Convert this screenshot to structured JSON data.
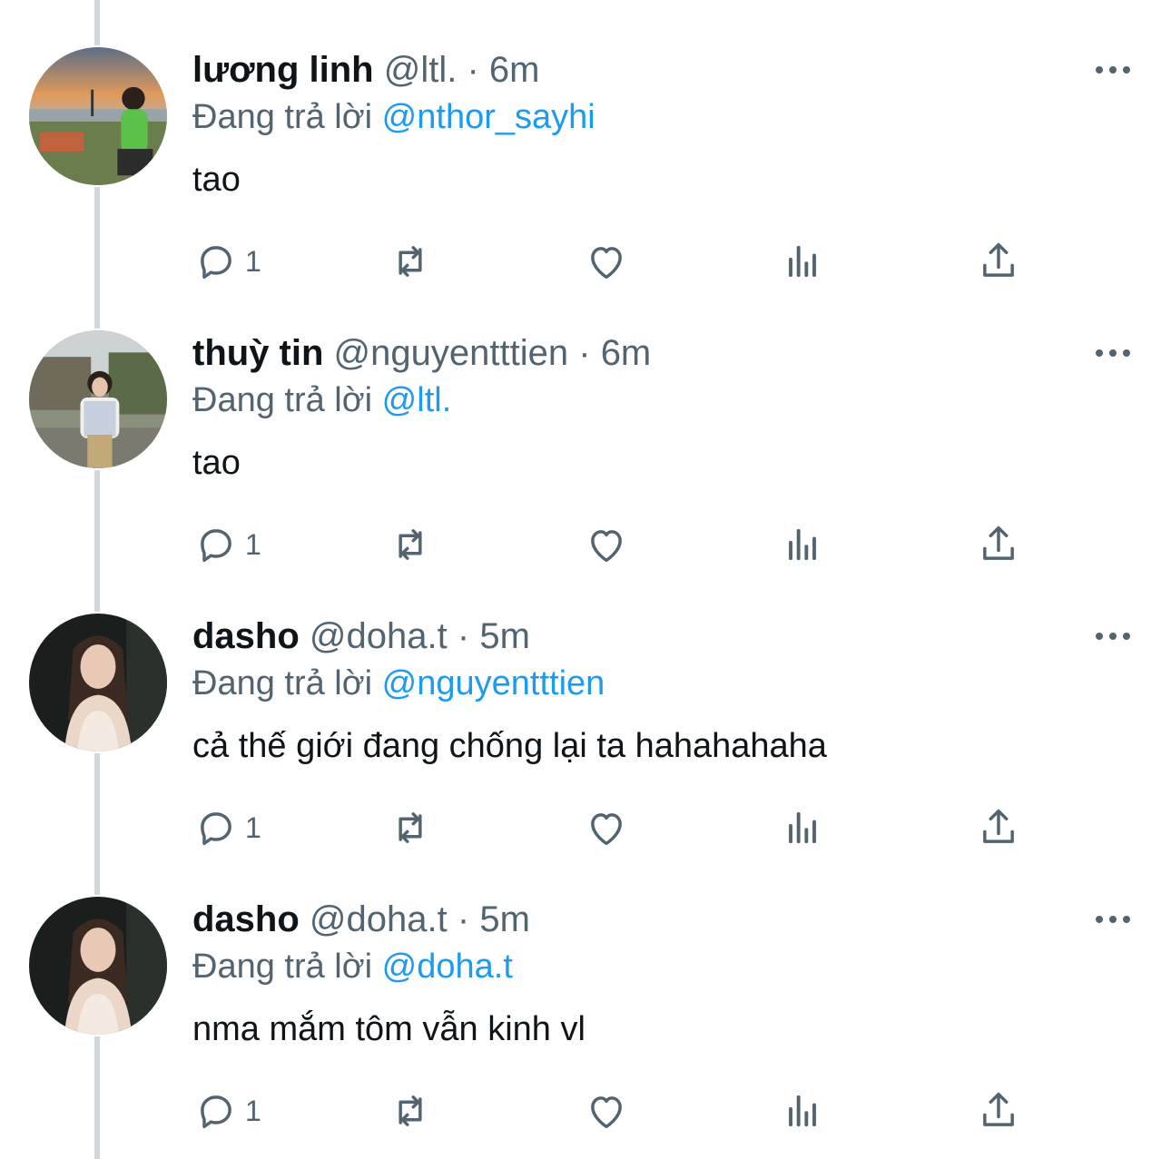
{
  "tweets": [
    {
      "name": "lương linh",
      "handle": "@ltl.",
      "time": "6m",
      "reply_prefix": "Đang trả lời",
      "reply_to": "@nthor_sayhi",
      "text": "tao",
      "reply_count": "1",
      "avatar_icon": "avatar-sunset-picnic"
    },
    {
      "name": "thuỳ tin",
      "handle": "@nguyentttien",
      "time": "6m",
      "reply_prefix": "Đang trả lời",
      "reply_to": "@ltl.",
      "text": "tao",
      "reply_count": "1",
      "avatar_icon": "avatar-girl-outdoor"
    },
    {
      "name": "dasho",
      "handle": "@doha.t",
      "time": "5m",
      "reply_prefix": "Đang trả lời",
      "reply_to": "@nguyentttien",
      "text": "cả thế giới đang chống lại ta hahahahaha",
      "reply_count": "1",
      "avatar_icon": "avatar-girl-night"
    },
    {
      "name": "dasho",
      "handle": "@doha.t",
      "time": "5m",
      "reply_prefix": "Đang trả lời",
      "reply_to": "@doha.t",
      "text": "nma mắm tôm vẫn kinh vl",
      "reply_count": "1",
      "avatar_icon": "avatar-girl-night"
    }
  ],
  "separator": "·",
  "icons": [
    "reply-icon",
    "retweet-icon",
    "like-icon",
    "views-icon",
    "share-icon",
    "more-icon"
  ],
  "colors": {
    "text": "#0f1419",
    "secondary": "#536471",
    "link": "#1d9bf0",
    "thread_line": "#cfd9de"
  }
}
